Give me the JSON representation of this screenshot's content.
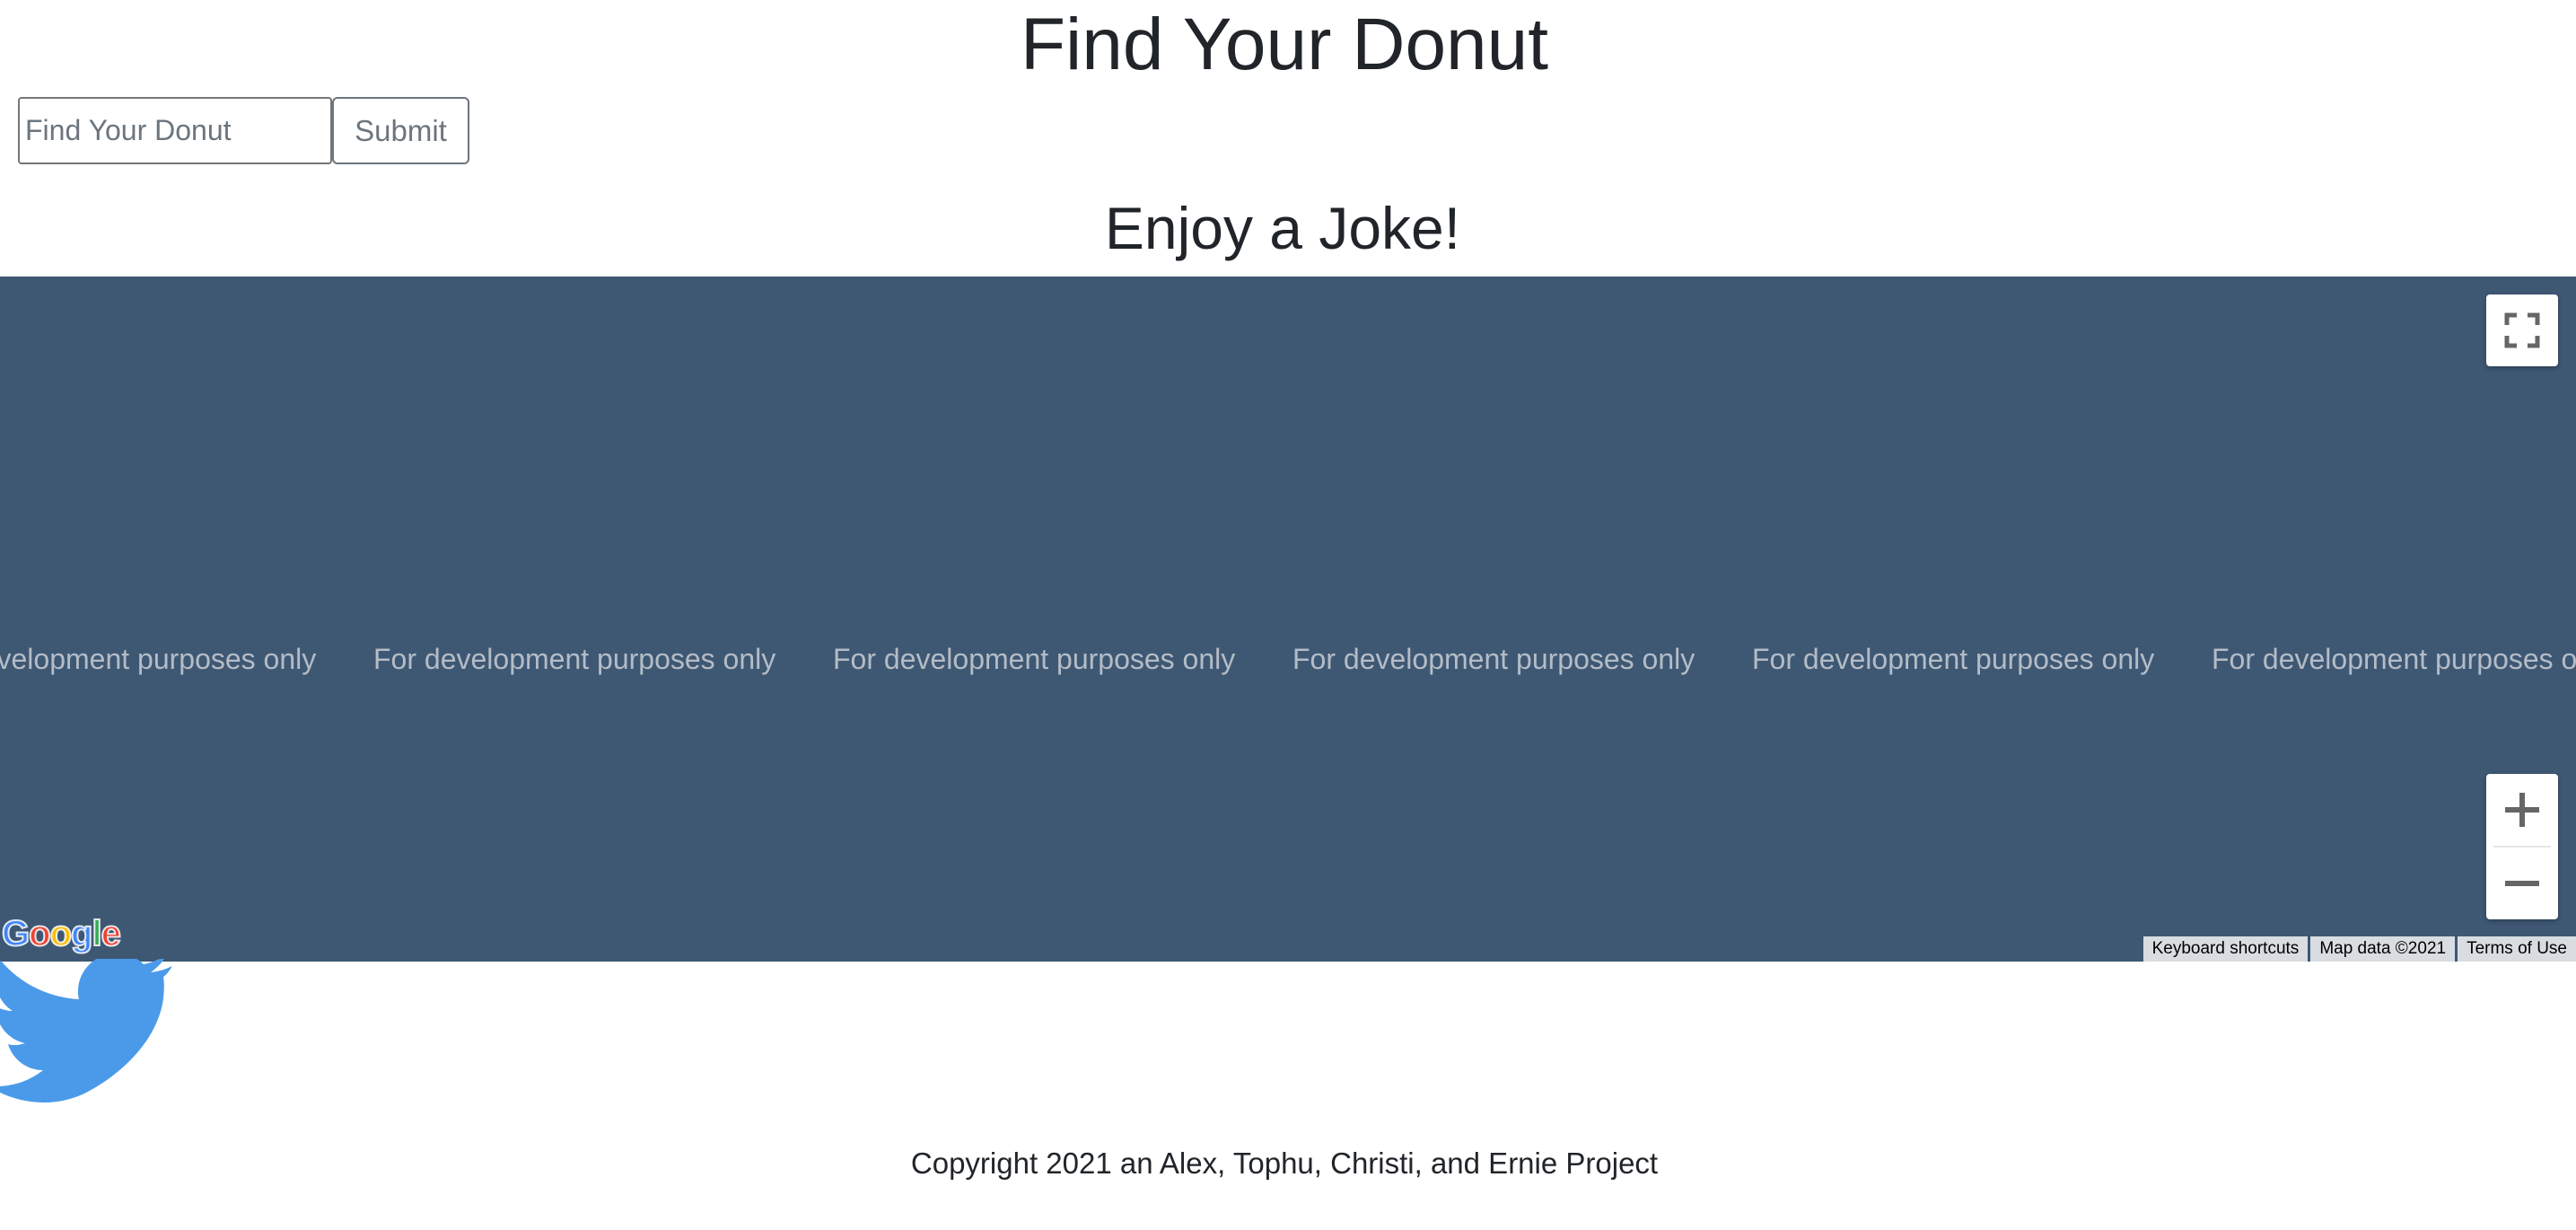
{
  "header": {
    "title": "Find Your Donut"
  },
  "search": {
    "placeholder": "Find Your Donut",
    "value": "",
    "submit_label": "Submit"
  },
  "joke": {
    "heading": "Enjoy a Joke!"
  },
  "map": {
    "background_color": "#3e5874",
    "watermark_text": "For development purposes only",
    "watermarks": [
      "For development purposes only",
      "For development purposes only",
      "For development purposes only",
      "For development purposes only",
      "For development purposes only",
      "For development purposes only"
    ],
    "logo_text": "Google",
    "fullscreen_icon": "fullscreen-icon",
    "zoom_in_icon": "plus-icon",
    "zoom_out_icon": "minus-icon",
    "attribution": {
      "keyboard_shortcuts": "Keyboard shortcuts",
      "map_data": "Map data ©2021",
      "terms": "Terms of Use"
    }
  },
  "social": {
    "icon": "twitter-bird-icon",
    "color": "#4a9ae9"
  },
  "footer": {
    "copyright": "Copyright 2021 an Alex, Tophu, Christi, and Ernie Project"
  }
}
